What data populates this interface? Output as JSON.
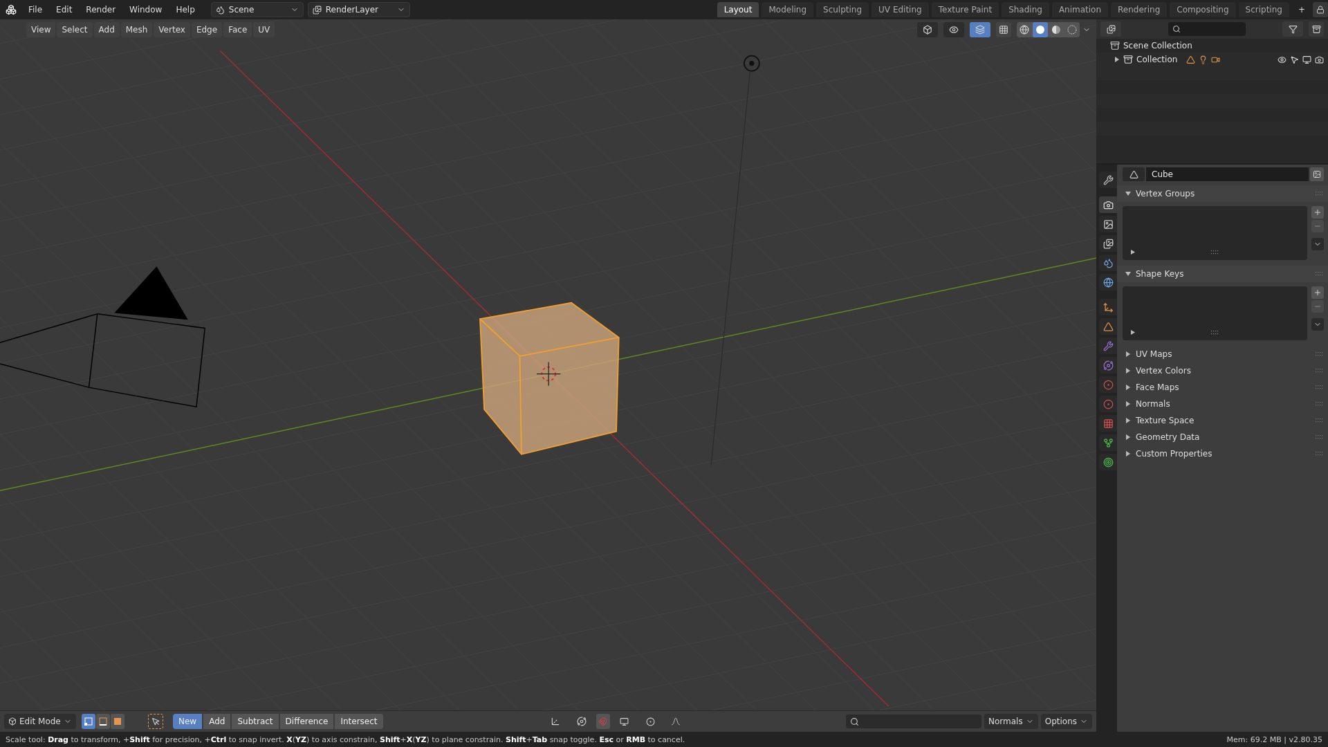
{
  "topbar": {
    "menus": [
      "File",
      "Edit",
      "Render",
      "Window",
      "Help"
    ],
    "scene": "Scene",
    "view_layer": "RenderLayer",
    "workspaces": [
      {
        "label": "Layout",
        "selected": true
      },
      {
        "label": "Modeling",
        "selected": false
      },
      {
        "label": "Sculpting",
        "selected": false
      },
      {
        "label": "UV Editing",
        "selected": false
      },
      {
        "label": "Texture Paint",
        "selected": false
      },
      {
        "label": "Shading",
        "selected": false
      },
      {
        "label": "Animation",
        "selected": false
      },
      {
        "label": "Rendering",
        "selected": false
      },
      {
        "label": "Compositing",
        "selected": false
      },
      {
        "label": "Scripting",
        "selected": false
      }
    ],
    "add_tab": "+"
  },
  "viewport": {
    "menus": [
      "View",
      "Select",
      "Add",
      "Mesh",
      "Vertex",
      "Edge",
      "Face",
      "UV"
    ],
    "overlays_on": true,
    "shading": [
      {
        "kind": "wireframe",
        "selected": false
      },
      {
        "kind": "solid",
        "selected": true
      },
      {
        "kind": "material",
        "selected": false
      },
      {
        "kind": "rendered",
        "selected": false
      }
    ]
  },
  "tool_header": {
    "mode": "Edit Mode",
    "select_modes": [
      {
        "kind": "vertex",
        "selected": true
      },
      {
        "kind": "edge",
        "selected": false
      },
      {
        "kind": "face",
        "selected": false
      }
    ],
    "boolean_modes": [
      {
        "label": "New",
        "selected": true
      },
      {
        "label": "Add",
        "selected": false
      },
      {
        "label": "Subtract",
        "selected": false
      },
      {
        "label": "Difference",
        "selected": false
      },
      {
        "label": "Intersect",
        "selected": false
      }
    ],
    "dropdowns": [
      "Normals",
      "Options"
    ]
  },
  "outliner": {
    "items": [
      {
        "label": "Scene Collection",
        "kind": "scene",
        "expanded": true
      },
      {
        "label": "Collection",
        "kind": "collection",
        "expanded": false
      }
    ]
  },
  "properties": {
    "tabs": [
      {
        "kind": "tool",
        "selected": false
      },
      {
        "kind": "render",
        "selected": true
      },
      {
        "kind": "output",
        "selected": false
      },
      {
        "kind": "view_layer",
        "selected": false
      },
      {
        "kind": "scene",
        "selected": false
      },
      {
        "kind": "world",
        "selected": false
      },
      {
        "kind": "object",
        "selected": false
      },
      {
        "kind": "mesh",
        "selected": false
      },
      {
        "kind": "modifier",
        "selected": false
      },
      {
        "kind": "particles",
        "selected": false
      },
      {
        "kind": "physics",
        "selected": false
      },
      {
        "kind": "material",
        "selected": false
      },
      {
        "kind": "texture",
        "selected": false
      },
      {
        "kind": "vertex_data",
        "selected": false
      },
      {
        "kind": "constraint",
        "selected": false
      }
    ],
    "data_name": "Cube",
    "panels": [
      {
        "label": "Vertex Groups",
        "expanded": true
      },
      {
        "label": "Shape Keys",
        "expanded": true
      },
      {
        "label": "UV Maps",
        "expanded": false
      },
      {
        "label": "Vertex Colors",
        "expanded": false
      },
      {
        "label": "Face Maps",
        "expanded": false
      },
      {
        "label": "Normals",
        "expanded": false
      },
      {
        "label": "Texture Space",
        "expanded": false
      },
      {
        "label": "Geometry Data",
        "expanded": false
      },
      {
        "label": "Custom Properties",
        "expanded": false
      }
    ]
  },
  "status_bar": {
    "message": "Scale tool: **Drag** to transform, +**Shift** for precision, +**Ctrl** to snap invert. **X**(**YZ**) to axis constrain, **Shift**+**X**(**YZ**) to plane constrain. **Shift**+**Tab** snap toggle. **Esc** or **RMB** to cancel.",
    "info": "Mem: 69.2 MB | v2.80.35"
  }
}
